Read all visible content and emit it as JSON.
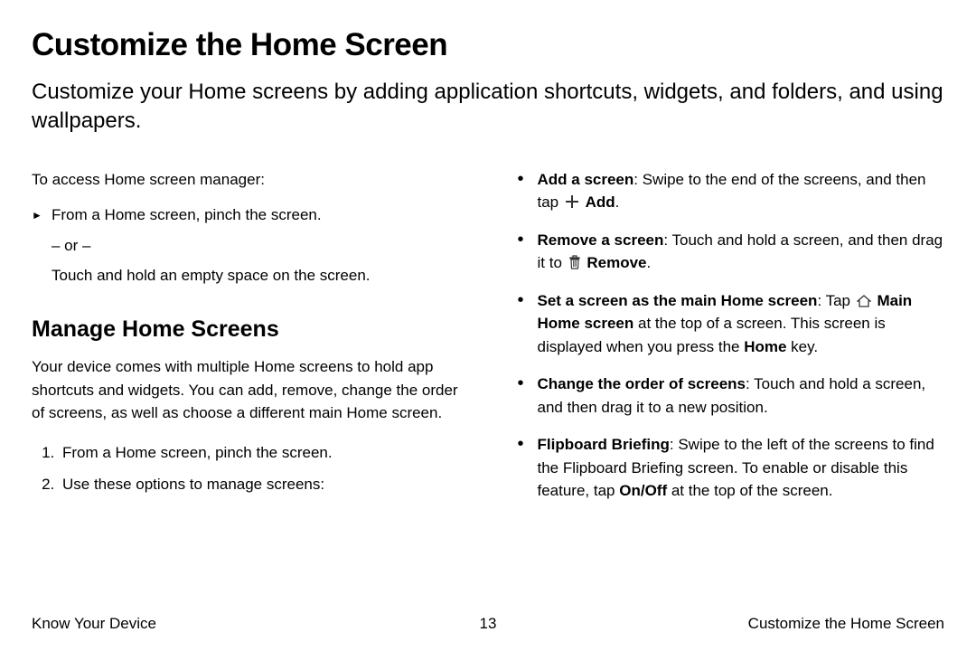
{
  "title": "Customize the Home Screen",
  "intro": "Customize your Home screens by adding application shortcuts, widgets, and folders, and using wallpapers.",
  "left": {
    "access": "To access Home screen manager:",
    "step1": "From a Home screen, pinch the screen.",
    "or": "– or –",
    "step2": "Touch and hold an empty space on the screen.",
    "h2": "Manage Home Screens",
    "manage_intro": "Your device comes with multiple Home screens to hold app shortcuts and widgets. You can add, remove, change the order of screens, as well as choose a different main Home screen.",
    "ol": [
      "From a Home screen, pinch the screen.",
      "Use these options to manage screens:"
    ]
  },
  "right": {
    "add_bold": "Add a screen",
    "add_text1": ": Swipe to the end of the screens, and then tap ",
    "add_label": "Add",
    "remove_bold": "Remove a screen",
    "remove_text1": ": Touch and hold a screen, and then drag it to ",
    "remove_label": "Remove",
    "main_bold": "Set a screen as the main Home screen",
    "main_text1": ": Tap ",
    "main_label": "Main Home screen",
    "main_text2": " at the top of a screen. This screen is displayed when you press the ",
    "home_key": "Home",
    "main_text3": " key.",
    "order_bold": "Change the order of screens",
    "order_text": ": Touch and hold a screen, and then drag it to a new position.",
    "flip_bold": "Flipboard Briefing",
    "flip_text1": ": Swipe to the left of the screens to find the Flipboard Briefing screen. To enable or disable this feature, tap ",
    "onoff": "On/Off",
    "flip_text2": " at the top of the screen."
  },
  "footer": {
    "left": "Know Your Device",
    "page": "13",
    "right": "Customize the Home Screen"
  }
}
